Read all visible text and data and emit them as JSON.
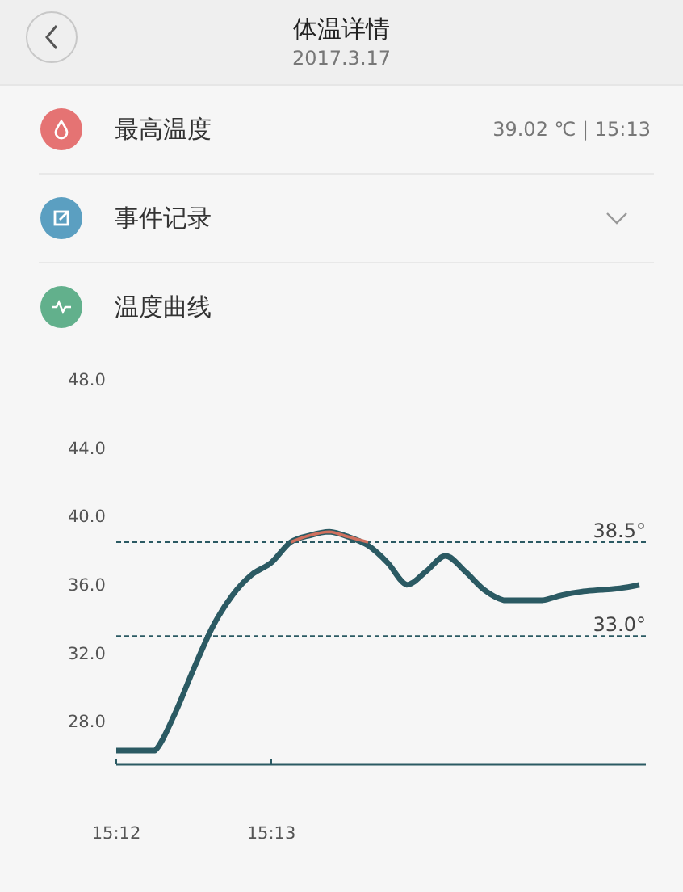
{
  "header": {
    "title": "体温详情",
    "date": "2017.3.17"
  },
  "rows": [
    {
      "kind": "value",
      "color": "#e57373",
      "label": "最高温度",
      "value": "39.02 ℃ | 15:13"
    },
    {
      "kind": "expand",
      "color": "#5b9fc1",
      "label": "事件记录",
      "expanded": false
    },
    {
      "kind": "plain",
      "color": "#62b08c",
      "label": "温度曲线"
    }
  ],
  "curve": {
    "chart_data": {
      "type": "line",
      "ylim": [
        25.5,
        48
      ],
      "yticks": [
        {
          "value": 28,
          "label": "28.0"
        },
        {
          "value": 32,
          "label": "32.0"
        },
        {
          "value": 36,
          "label": "36.0"
        },
        {
          "value": 40,
          "label": "40.0"
        },
        {
          "value": 44,
          "label": "44.0"
        },
        {
          "value": 48,
          "label": "48.0"
        }
      ],
      "categories": [
        "15:12",
        null,
        null,
        null,
        null,
        null,
        null,
        null,
        "15:13",
        null,
        null,
        null,
        null,
        null,
        null,
        null,
        null,
        null,
        null,
        null,
        null,
        null,
        null,
        null,
        null,
        null,
        null,
        null
      ],
      "series": [
        {
          "color": "#2b5a63",
          "values": [
            26.3,
            26.3,
            26.3,
            28.4,
            31.1,
            33.6,
            35.4,
            36.6,
            37.3,
            38.5,
            38.9,
            39.1,
            38.8,
            38.3,
            37.3,
            36.0,
            36.8,
            37.7,
            36.8,
            35.7,
            35.1,
            35.1,
            35.1,
            35.4,
            35.6,
            35.7,
            35.8,
            36.0
          ]
        },
        {
          "color": "#d0705e",
          "values": [
            null,
            null,
            null,
            null,
            null,
            null,
            null,
            null,
            null,
            38.5,
            38.9,
            39.1,
            38.8,
            38.5,
            null,
            null,
            null,
            null,
            null,
            null,
            null,
            null,
            null,
            null,
            null,
            null,
            null,
            null
          ]
        }
      ],
      "ref_lines": [
        {
          "axis": "y",
          "value": 38.5,
          "label": "38.5°"
        },
        {
          "axis": "y",
          "value": 33.0,
          "label": "33.0°"
        }
      ]
    }
  }
}
